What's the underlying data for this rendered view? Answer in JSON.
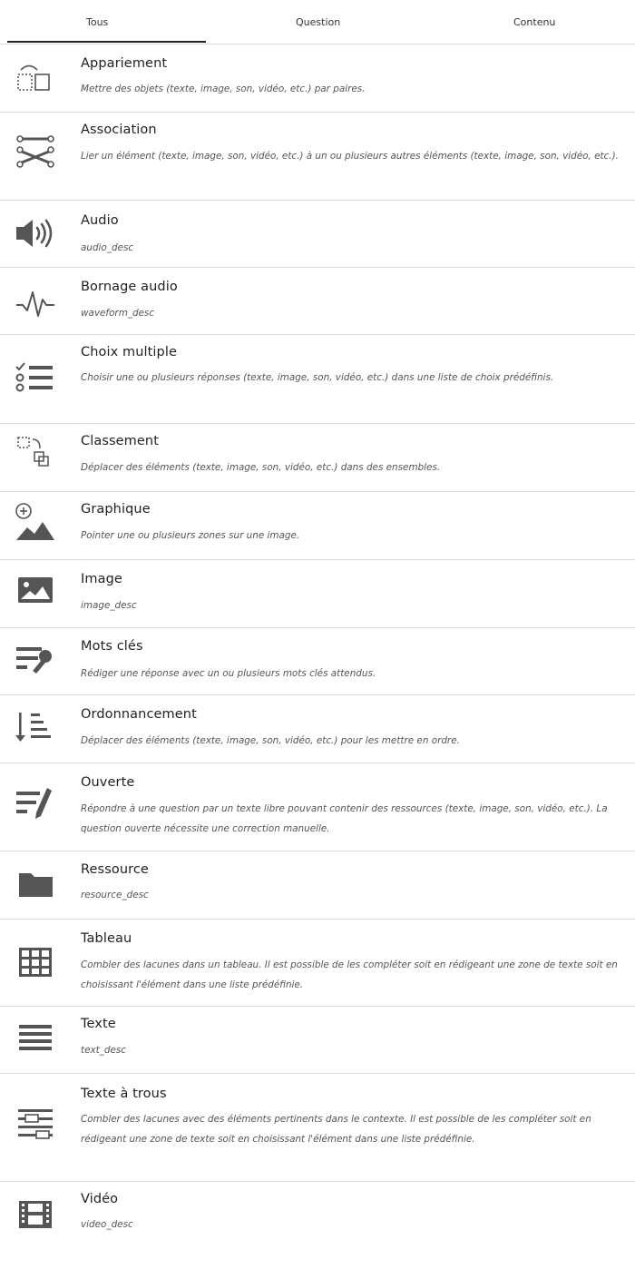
{
  "tabs": [
    {
      "label": "Tous"
    },
    {
      "label": "Question"
    },
    {
      "label": "Contenu"
    }
  ],
  "items": [
    {
      "title": "Appariement",
      "desc": "Mettre des objets (texte, image, son, vidéo, etc.) par paires.",
      "icon": "pairing-icon"
    },
    {
      "title": "Association",
      "desc": "Lier un élément (texte, image, son, vidéo, etc.) à un ou plusieurs autres éléments (texte, image, son, vidéo, etc.).",
      "icon": "association-icon"
    },
    {
      "title": "Audio",
      "desc": "audio_desc",
      "icon": "speaker-icon"
    },
    {
      "title": "Bornage audio",
      "desc": "waveform_desc",
      "icon": "waveform-icon"
    },
    {
      "title": "Choix multiple",
      "desc": "Choisir une ou plusieurs réponses (texte, image, son, vidéo, etc.) dans une liste de choix prédéfinis.",
      "icon": "checklist-icon"
    },
    {
      "title": "Classement",
      "desc": "Déplacer des éléments (texte, image, son, vidéo, etc.) dans des ensembles.",
      "icon": "sorting-icon"
    },
    {
      "title": "Graphique",
      "desc": "Pointer une ou plusieurs zones sur une image.",
      "icon": "graphic-zone-icon"
    },
    {
      "title": "Image",
      "desc": "image_desc",
      "icon": "image-icon"
    },
    {
      "title": "Mots clés",
      "desc": "Rédiger une réponse avec un ou plusieurs mots clés attendus.",
      "icon": "keywords-icon"
    },
    {
      "title": "Ordonnancement",
      "desc": "Déplacer des éléments (texte, image, son, vidéo, etc.) pour les mettre en ordre.",
      "icon": "ordering-icon"
    },
    {
      "title": "Ouverte",
      "desc": "Répondre à une question par un texte libre pouvant contenir des ressources (texte, image, son, vidéo, etc.). La question ouverte nécessite une correction manuelle.",
      "icon": "open-question-icon"
    },
    {
      "title": "Ressource",
      "desc": "resource_desc",
      "icon": "folder-icon"
    },
    {
      "title": "Tableau",
      "desc": "Combler des lacunes dans un tableau. Il est possible de les compléter soit en rédigeant une zone de texte soit en choisissant l'élément dans une liste prédéfinie.",
      "icon": "table-icon"
    },
    {
      "title": "Texte",
      "desc": "text_desc",
      "icon": "text-lines-icon"
    },
    {
      "title": "Texte à trous",
      "desc": "Combler des lacunes avec des éléments pertinents dans le contexte. Il est possible de les compléter soit en rédigeant une zone de texte soit en choisissant l'élément dans une liste prédéfinie.",
      "icon": "fill-blanks-icon"
    },
    {
      "title": "Vidéo",
      "desc": "video_desc",
      "icon": "film-icon"
    }
  ]
}
